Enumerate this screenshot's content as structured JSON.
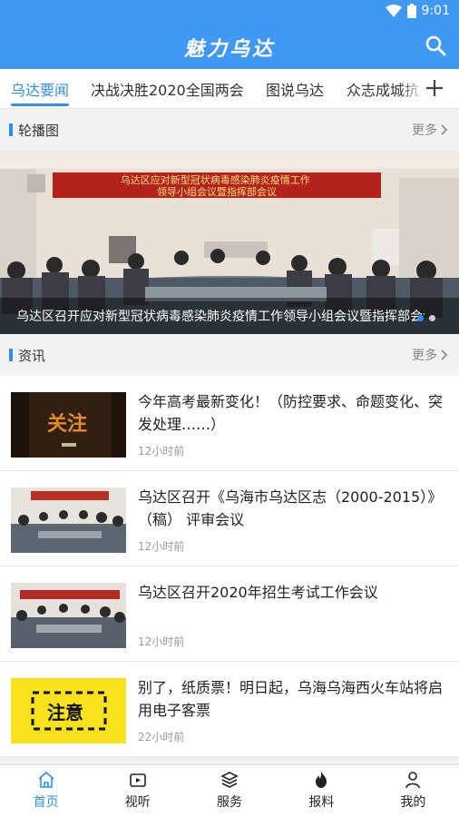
{
  "status_bar": {
    "time": "9:01",
    "wifi_icon": "wifi-icon",
    "battery_icon": "battery-icon"
  },
  "header": {
    "title": "魅力乌达",
    "search_icon": "search-icon"
  },
  "tabs": [
    {
      "label": "乌达要闻",
      "active": true
    },
    {
      "label": "决战决胜2020全国两会",
      "active": false
    },
    {
      "label": "图说乌达",
      "active": false
    },
    {
      "label": "众志成城抗",
      "active": false
    }
  ],
  "add_channel_icon": "plus-icon",
  "carousel_section": {
    "title": "轮播图",
    "more": "更多"
  },
  "carousel": {
    "banner_text": "乌达区应对新型冠状病毒感染肺炎疫情工作\n领导小组会议暨指挥部会议",
    "caption": "乌达区召开应对新型冠状病毒感染肺炎疫情工作领导小组会议暨指挥部会议",
    "slide_count": 2,
    "active_slide": 1
  },
  "news_section": {
    "title": "资讯",
    "more": "更多"
  },
  "news": [
    {
      "title": "今年高考最新变化！（防控要求、命题变化、突发处理……）",
      "time": "12小时前",
      "thumb_text": "关注"
    },
    {
      "title": "乌达区召开《乌海市乌达区志（2000-2015）》（稿） 评审会议",
      "time": "12小时前",
      "thumb_text": ""
    },
    {
      "title": "乌达区召开2020年招生考试工作会议",
      "time": "12小时前",
      "thumb_text": ""
    },
    {
      "title": "别了，纸质票！明日起，乌海乌海西火车站将启用电子客票",
      "time": "22小时前",
      "thumb_text": "注意"
    }
  ],
  "bottom_nav": [
    {
      "label": "首页",
      "icon": "home-icon",
      "active": true
    },
    {
      "label": "视听",
      "icon": "video-icon",
      "active": false
    },
    {
      "label": "服务",
      "icon": "layers-icon",
      "active": false
    },
    {
      "label": "报料",
      "icon": "fire-icon",
      "active": false
    },
    {
      "label": "我的",
      "icon": "user-icon",
      "active": false
    }
  ],
  "colors": {
    "brand": "#3f98f2",
    "accent": "#2f8ff0",
    "text": "#222222",
    "muted": "#999999"
  }
}
